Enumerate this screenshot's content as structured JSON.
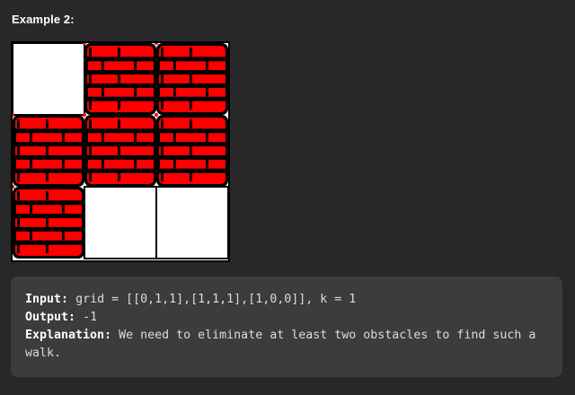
{
  "heading": "Example 2:",
  "grid": {
    "rows": [
      [
        0,
        1,
        1
      ],
      [
        1,
        1,
        1
      ],
      [
        1,
        0,
        0
      ]
    ],
    "colors": {
      "empty": "#ffffff",
      "brick": "#ff0000",
      "mortar": "#000000",
      "corner_marker": "#ff0000"
    }
  },
  "example": {
    "input_label": "Input:",
    "input_value": "grid = [[0,1,1],[1,1,1],[1,0,0]], k = 1",
    "output_label": "Output:",
    "output_value": "-1",
    "explanation_label": "Explanation:",
    "explanation_value": "We need to eliminate at least two obstacles to find such a walk."
  }
}
